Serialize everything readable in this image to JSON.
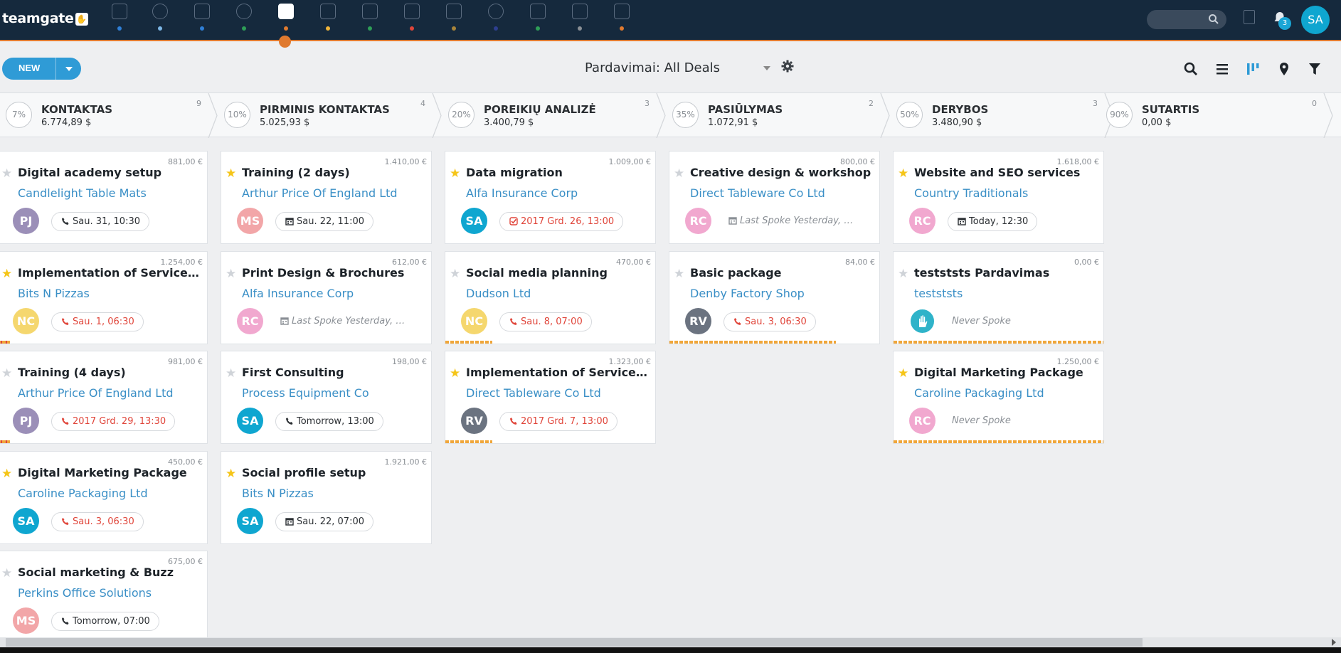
{
  "brand": {
    "logo_text": "teamgate"
  },
  "topbar": {
    "nav_icons": [
      {
        "name": "dashboard-icon",
        "dot_color": "#2f7fd6"
      },
      {
        "name": "goals-icon",
        "dot_color": "#7db7e6"
      },
      {
        "name": "companies-icon",
        "dot_color": "#2f7fd6"
      },
      {
        "name": "people-icon",
        "dot_color": "#2e9e57"
      },
      {
        "name": "deals-icon",
        "dot_color": "#e07a2f",
        "active": true
      },
      {
        "name": "calendar-icon",
        "dot_color": "#f0b43a"
      },
      {
        "name": "chat-icon",
        "dot_color": "#2e9e57"
      },
      {
        "name": "inbox-icon",
        "dot_color": "#e0453a"
      },
      {
        "name": "clipboard-icon",
        "dot_color": "#a8843a"
      },
      {
        "name": "reports-icon",
        "dot_color": "#2d3e8f"
      },
      {
        "name": "messages-icon",
        "dot_color": "#2e9e57"
      },
      {
        "name": "notes-icon",
        "dot_color": "#8a8f95"
      },
      {
        "name": "documents-icon",
        "dot_color": "#e07a2f"
      }
    ],
    "search_placeholder": "",
    "notification_count": "3",
    "user_initials": "SA"
  },
  "toolbar": {
    "new_label": "NEW",
    "view_title": "Pardavimai: All Deals"
  },
  "stages": [
    {
      "pct": "7%",
      "name": "KONTAKTAS",
      "total": "6.774,89 $",
      "count": "9"
    },
    {
      "pct": "10%",
      "name": "PIRMINIS KONTAKTAS",
      "total": "5.025,93 $",
      "count": "4"
    },
    {
      "pct": "20%",
      "name": "POREIKIŲ ANALIZĖ",
      "total": "3.400,79 $",
      "count": "3"
    },
    {
      "pct": "35%",
      "name": "PASIŪLYMAS",
      "total": "1.072,91 $",
      "count": "2"
    },
    {
      "pct": "50%",
      "name": "DERYBOS",
      "total": "3.480,90 $",
      "count": "3"
    },
    {
      "pct": "90%",
      "name": "SUTARTIS",
      "total": "0,00 $",
      "count": "0"
    }
  ],
  "columns": [
    [
      {
        "amount": "881,00 €",
        "starred": false,
        "title": "Digital academy setup",
        "company": "Candlelight Table Mats",
        "initials": "PJ",
        "avatar_color": "#9b8fb8",
        "activity_icon": "phone",
        "activity": "Sau. 31, 10:30",
        "overdue": false,
        "bar": "none"
      },
      {
        "amount": "1.254,00 €",
        "starred": true,
        "title": "Implementation of Service D...",
        "company": "Bits N Pizzas",
        "initials": "NC",
        "avatar_color": "#f5d76e",
        "activity_icon": "phone",
        "activity": "Sau. 1, 06:30",
        "overdue": true,
        "bar": "short-red"
      },
      {
        "amount": "981,00 €",
        "starred": false,
        "title": "Training (4 days)",
        "company": "Arthur Price Of England Ltd",
        "initials": "PJ",
        "avatar_color": "#9b8fb8",
        "activity_icon": "phone",
        "activity": "2017 Grd. 29, 13:30",
        "overdue": true,
        "bar": "short-red"
      },
      {
        "amount": "450,00 €",
        "starred": true,
        "title": "Digital Marketing Package",
        "company": "Caroline Packaging Ltd",
        "initials": "SA",
        "avatar_color": "#0fa6d0",
        "activity_icon": "phone",
        "activity": "Sau. 3, 06:30",
        "overdue": true,
        "bar": "none"
      },
      {
        "amount": "675,00 €",
        "starred": false,
        "title": "Social marketing & Buzz",
        "company": "Perkins Office Solutions",
        "initials": "MS",
        "avatar_color": "#f2a6a8",
        "activity_icon": "phone",
        "activity": "Tomorrow, 07:00",
        "overdue": false,
        "bar": "none"
      }
    ],
    [
      {
        "amount": "1.410,00 €",
        "starred": true,
        "title": "Training (2 days)",
        "company": "Arthur Price Of England Ltd",
        "initials": "MS",
        "avatar_color": "#f2a6a8",
        "activity_icon": "calendar",
        "activity": "Sau. 22, 11:00",
        "overdue": false,
        "bar": "none"
      },
      {
        "amount": "612,00 €",
        "starred": false,
        "title": "Print Design & Brochures",
        "company": "Alfa Insurance Corp",
        "initials": "RC",
        "avatar_color": "#f1a8cf",
        "activity_icon": "calendar",
        "activity": "Last Spoke Yesterday, 12:...",
        "muted": true,
        "bar": "none"
      },
      {
        "amount": "198,00 €",
        "starred": false,
        "title": "First Consulting",
        "company": "Process Equipment Co",
        "initials": "SA",
        "avatar_color": "#0fa6d0",
        "activity_icon": "phone",
        "activity": "Tomorrow, 13:00",
        "overdue": false,
        "bar": "none"
      },
      {
        "amount": "1.921,00 €",
        "starred": true,
        "title": "Social profile setup",
        "company": "Bits N Pizzas",
        "initials": "SA",
        "avatar_color": "#0fa6d0",
        "activity_icon": "calendar",
        "activity": "Sau. 22, 07:00",
        "overdue": false,
        "bar": "none"
      }
    ],
    [
      {
        "amount": "1.009,00 €",
        "starred": true,
        "title": "Data migration",
        "company": "Alfa Insurance Corp",
        "initials": "SA",
        "avatar_color": "#0fa6d0",
        "activity_icon": "task",
        "activity": "2017 Grd. 26, 13:00",
        "overdue": true,
        "bar": "none"
      },
      {
        "amount": "470,00 €",
        "starred": false,
        "title": "Social media planning",
        "company": "Dudson Ltd",
        "initials": "NC",
        "avatar_color": "#f5d76e",
        "activity_icon": "phone",
        "activity": "Sau. 8, 07:00",
        "overdue": true,
        "bar": "mid"
      },
      {
        "amount": "1.323,00 €",
        "starred": true,
        "title": "Implementation of Service D...",
        "company": "Direct Tableware Co Ltd",
        "initials": "RV",
        "avatar_color": "#6b7380",
        "activity_icon": "phone",
        "activity": "2017 Grd. 7, 13:00",
        "overdue": true,
        "bar": "mid"
      }
    ],
    [
      {
        "amount": "800,00 €",
        "starred": false,
        "title": "Creative design & workshop",
        "company": "Direct Tableware Co Ltd",
        "initials": "RC",
        "avatar_color": "#f1a8cf",
        "activity_icon": "calendar",
        "activity": "Last Spoke Yesterday, 10:...",
        "muted": true,
        "bar": "none"
      },
      {
        "amount": "84,00 €",
        "starred": false,
        "title": "Basic package",
        "company": "Denby Factory Shop",
        "initials": "RV",
        "avatar_color": "#6b7380",
        "activity_icon": "phone",
        "activity": "Sau. 3, 06:30",
        "overdue": true,
        "bar": "long"
      }
    ],
    [
      {
        "amount": "1.618,00 €",
        "starred": true,
        "title": "Website and SEO services",
        "company": "Country Traditionals",
        "initials": "RC",
        "avatar_color": "#f1a8cf",
        "activity_icon": "calendar",
        "activity": "Today, 12:30",
        "overdue": false,
        "bar": "none"
      },
      {
        "amount": "0,00 €",
        "starred": false,
        "title": "testststs Pardavimas",
        "company": "testststs",
        "initials": "",
        "avatar_color": "#2fb3c9",
        "logo_avatar": true,
        "activity": "Never Spoke",
        "muted": true,
        "bar": "full"
      },
      {
        "amount": "1.250,00 €",
        "starred": true,
        "title": "Digital Marketing Package",
        "company": "Caroline Packaging Ltd",
        "initials": "RC",
        "avatar_color": "#f1a8cf",
        "activity": "Never Spoke",
        "muted": true,
        "bar": "full"
      }
    ],
    []
  ]
}
